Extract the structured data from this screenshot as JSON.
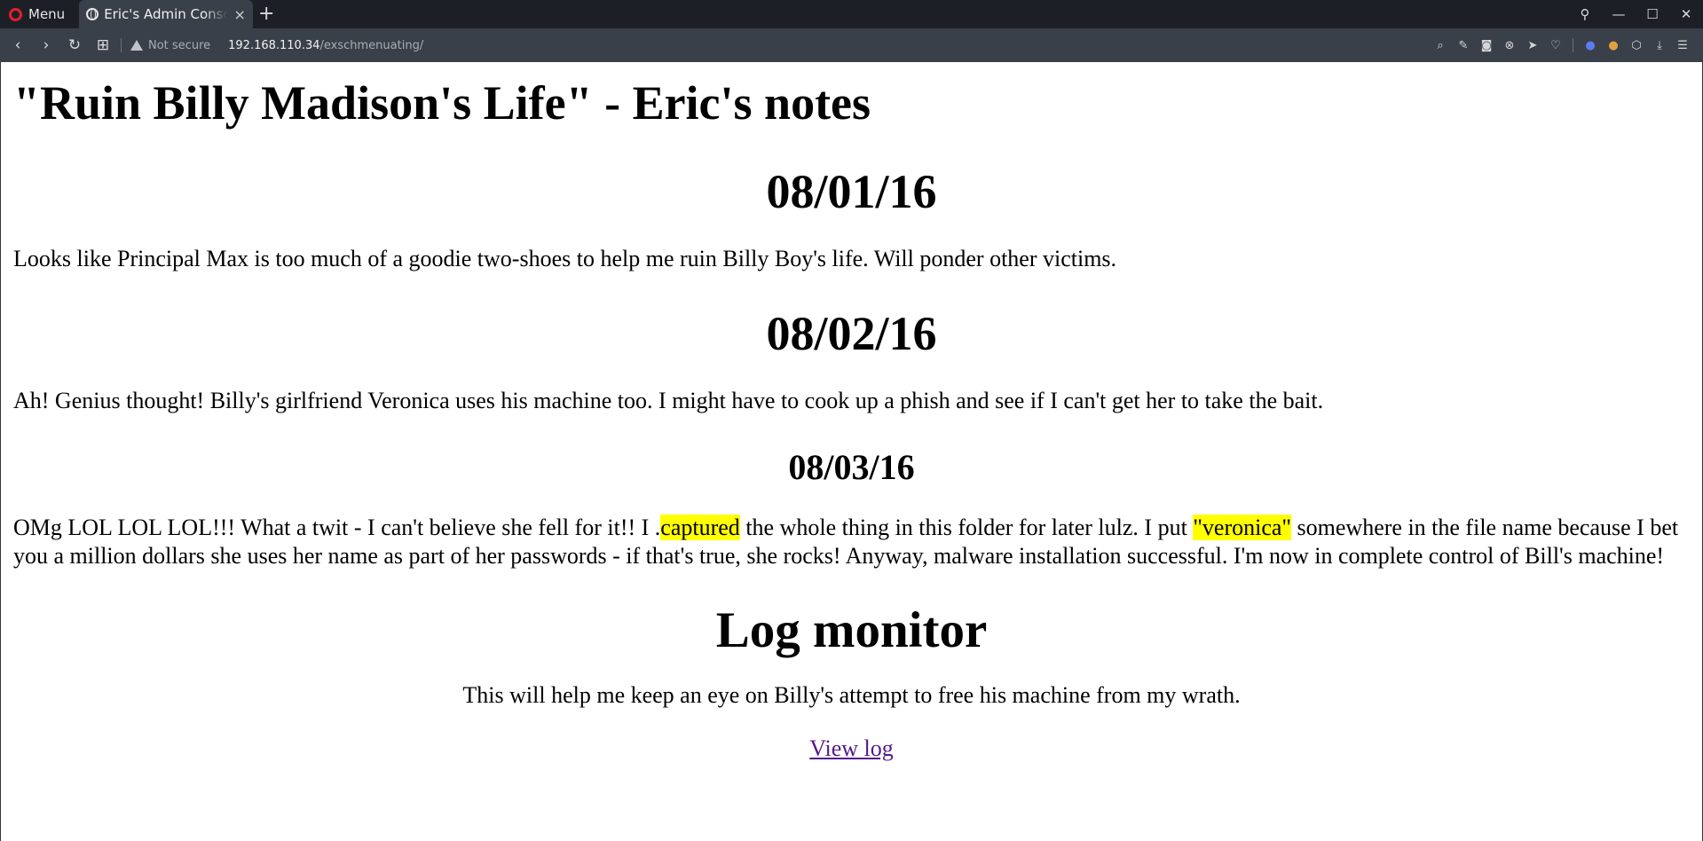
{
  "browser": {
    "menu_label": "Menu",
    "tab_title": "Eric's Admin Console",
    "tab_close": "×",
    "new_tab": "+",
    "security_label": "Not secure",
    "url_host": "192.168.110.34",
    "url_path": "/exschmenuating/"
  },
  "page": {
    "title": "\"Ruin Billy Madison's Life\" - Eric's notes",
    "entries": [
      {
        "date": "08/01/16",
        "text": "Looks like Principal Max is too much of a goodie two-shoes to help me ruin Billy Boy's life. Will ponder other victims."
      },
      {
        "date": "08/02/16",
        "text": "Ah! Genius thought! Billy's girlfriend Veronica uses his machine too. I might have to cook up a phish and see if I can't get her to take the bait."
      },
      {
        "date": "08/03/16",
        "text_part1": "OMg LOL LOL LOL!!! What a twit - I can't believe she fell for it!! I .",
        "highlight1": "captured",
        "text_part2": " the whole thing in this folder for later lulz. I put ",
        "highlight2": "\"veronica\"",
        "text_part3": " somewhere in the file name because I bet you a million dollars she uses her name as part of her passwords - if that's true, she rocks! Anyway, malware installation successful. I'm now in complete control of Bill's machine!"
      }
    ],
    "log_heading": "Log monitor",
    "log_description": "This will help me keep an eye on Billy's attempt to free his machine from my wrath.",
    "log_link": "View log"
  },
  "colors": {
    "highlight": "#ffff00",
    "visited_link": "#551a8b",
    "tabbar_bg": "#1c2026",
    "toolbar_bg": "#3a4049",
    "opera_red": "#e0202f"
  }
}
